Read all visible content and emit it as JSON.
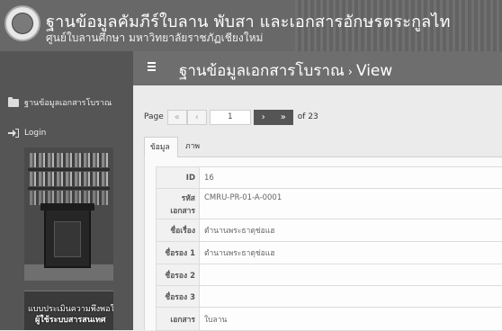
{
  "banner": {
    "title": "ฐานข้อมูลคัมภีร์ใบลาน พับสา และเอกสารอักษรตระกูลไท",
    "subtitle": "ศูนย์ใบลานศึกษา มหาวิทยาลัยราชภัฏเชียงใหม่"
  },
  "sidebar": {
    "items": [
      {
        "label": "ฐานข้อมูลเอกสารโบราณ",
        "icon": "folder-icon"
      },
      {
        "label": "Login",
        "icon": "sign-in-icon"
      }
    ],
    "banner_line1": "แบบประเมินความพึงพอใจ",
    "banner_line2": "ผู้ใช้ระบบสารสนเทศ"
  },
  "topbar": {
    "title": "ฐานข้อมูลเอกสารโบราณ",
    "separator": "›",
    "page": "View"
  },
  "pager": {
    "label": "Page",
    "first": "«",
    "prev": "‹",
    "current": "1",
    "next": "›",
    "last": "»",
    "total": "of 23"
  },
  "tabs": [
    {
      "label": "ข้อมูล",
      "active": true
    },
    {
      "label": "ภาพ",
      "active": false
    }
  ],
  "details": [
    {
      "key": "ID",
      "value": "16"
    },
    {
      "key": "รหัสเอกสาร",
      "value": "CMRU-PR-01-A-0001"
    },
    {
      "key": "ชื่อเรื่อง",
      "value": "ตำนานพระธาตุช่อแฮ"
    },
    {
      "key": "ชื่อรอง 1",
      "value": "ตำนานพระธาตุช่อแฮ"
    },
    {
      "key": "ชื่อรอง 2",
      "value": ""
    },
    {
      "key": "ชื่อรอง 3",
      "value": ""
    },
    {
      "key": "เอกสาร",
      "value": "ใบลาน"
    }
  ]
}
